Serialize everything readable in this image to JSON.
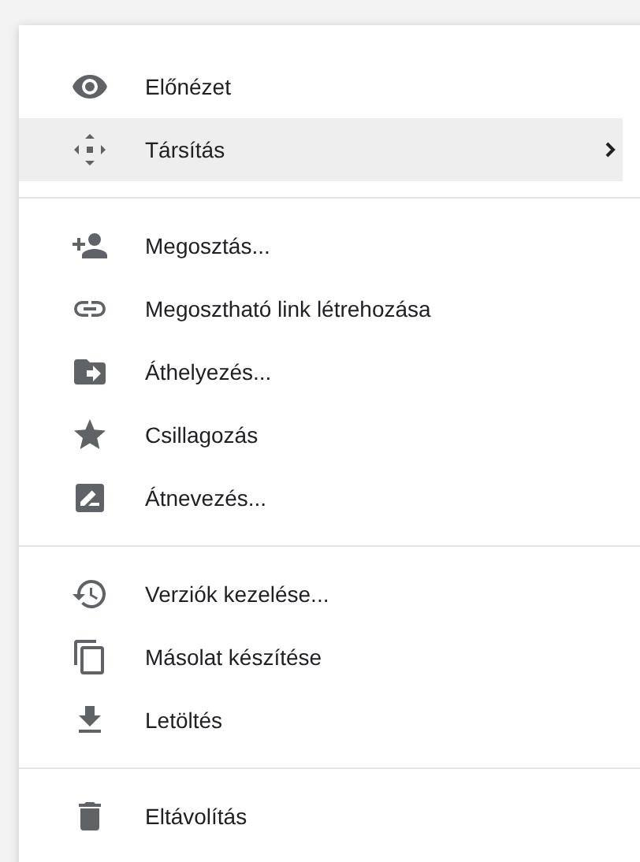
{
  "menu": {
    "sections": [
      {
        "items": [
          {
            "label": "Előnézet",
            "selected": false,
            "submenu": false
          },
          {
            "label": "Társítás",
            "selected": true,
            "submenu": true
          }
        ]
      },
      {
        "items": [
          {
            "label": "Megosztás...",
            "selected": false,
            "submenu": false
          },
          {
            "label": "Megosztható link létrehozása",
            "selected": false,
            "submenu": false
          },
          {
            "label": "Áthelyezés...",
            "selected": false,
            "submenu": false
          },
          {
            "label": "Csillagozás",
            "selected": false,
            "submenu": false
          },
          {
            "label": "Átnevezés...",
            "selected": false,
            "submenu": false
          }
        ]
      },
      {
        "items": [
          {
            "label": "Verziók kezelése...",
            "selected": false,
            "submenu": false
          },
          {
            "label": "Másolat készítése",
            "selected": false,
            "submenu": false
          },
          {
            "label": "Letöltés",
            "selected": false,
            "submenu": false
          }
        ]
      },
      {
        "items": [
          {
            "label": "Eltávolítás",
            "selected": false,
            "submenu": false
          }
        ]
      }
    ]
  }
}
